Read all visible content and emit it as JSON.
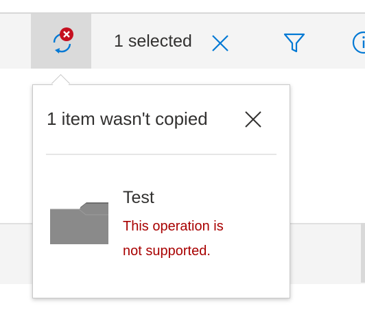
{
  "toolbar": {
    "selected_label": "1 selected",
    "sync_icon": "sync-error-icon",
    "clear_icon": "close-icon",
    "filter_icon": "filter-icon",
    "info_icon": "info-icon"
  },
  "callout": {
    "title": "1 item wasn't copied",
    "close_icon": "close-icon",
    "items": [
      {
        "name": "Test",
        "icon": "folder-icon",
        "error_message": "This operation is not supported."
      }
    ]
  },
  "colors": {
    "error_red": "#a80000",
    "badge_red": "#c50f1f",
    "accent_blue": "#0078d4",
    "folder_gray": "#8a8a8a"
  }
}
